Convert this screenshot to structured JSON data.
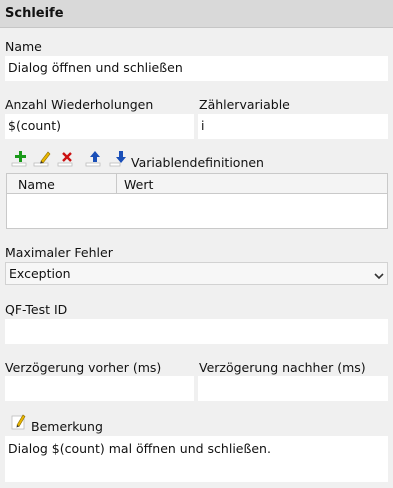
{
  "header": {
    "title": "Schleife"
  },
  "name": {
    "label": "Name",
    "value": "Dialog öffnen und schließen"
  },
  "repetitions": {
    "label": "Anzahl Wiederholungen",
    "value": "$(count)"
  },
  "counter": {
    "label": "Zählervariable",
    "value": "i"
  },
  "variables": {
    "label": "Variablendefinitionen",
    "columns": [
      "Name",
      "Wert"
    ],
    "toolbar": [
      "add-icon",
      "edit-icon",
      "delete-icon",
      "move-up-icon",
      "move-down-icon"
    ],
    "colors": {
      "add": "#1a9a1a",
      "edit": "#d4a200",
      "delete": "#cc1111",
      "move": "#1a4fb8"
    }
  },
  "max_error": {
    "label": "Maximaler Fehler",
    "value": "Exception"
  },
  "qftest_id": {
    "label": "QF-Test ID",
    "value": ""
  },
  "delay_before": {
    "label": "Verzögerung vorher (ms)",
    "value": ""
  },
  "delay_after": {
    "label": "Verzögerung nachher (ms)",
    "value": ""
  },
  "comment": {
    "label": "Bemerkung",
    "value": "Dialog $(count) mal öffnen und schließen."
  }
}
